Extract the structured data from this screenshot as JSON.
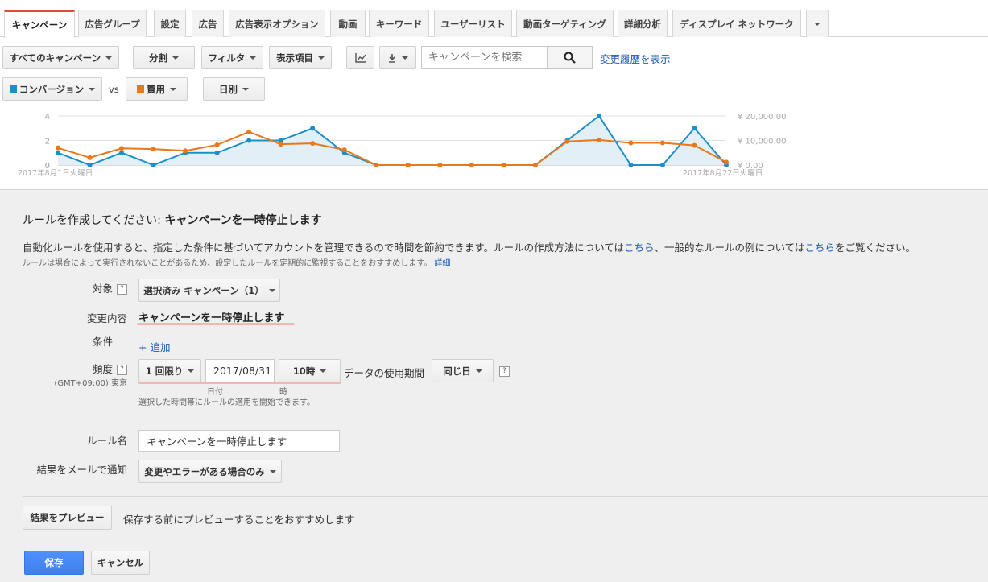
{
  "tabs": [
    "キャンペーン",
    "広告グループ",
    "設定",
    "広告",
    "広告表示オプション",
    "動画",
    "キーワード",
    "ユーザーリスト",
    "動画ターゲティング",
    "詳細分析",
    "ディスプレイ ネットワーク"
  ],
  "toolbar": {
    "all_campaigns": "すべてのキャンペーン",
    "segment": "分割",
    "filter": "フィルタ",
    "columns": "表示項目",
    "search_placeholder": "キャンペーンを検索",
    "change_history": "変更履歴を表示"
  },
  "metrics": {
    "metric1": "コンバージョン",
    "vs": "vs",
    "metric2": "費用",
    "period": "日別",
    "color1": "#1a8fc9",
    "color2": "#e8781c"
  },
  "chart_data": {
    "type": "line",
    "x": [
      "2017年8月1日火曜日",
      "",
      "",
      "",
      "",
      "",
      "",
      "",
      "",
      "",
      "",
      "",
      "",
      "",
      "",
      "",
      "",
      "",
      "",
      "",
      "",
      "2017年8月22日火曜日"
    ],
    "x_labels": [
      "2017年8月1日火曜日",
      "2017年8月22日火曜日"
    ],
    "left_ticks": [
      "4",
      "2",
      "0"
    ],
    "right_ticks": [
      "¥ 20,000.00",
      "¥ 10,000.00",
      "¥ 0.00"
    ],
    "series": [
      {
        "name": "コンバージョン",
        "axis": "left",
        "values": [
          1,
          0,
          1,
          0,
          1,
          1,
          2,
          2,
          3,
          1,
          0,
          0,
          0,
          0,
          0,
          0,
          2,
          4,
          0,
          0,
          3,
          0
        ]
      },
      {
        "name": "費用",
        "axis": "right",
        "values": [
          7000,
          3000,
          6800,
          6500,
          5800,
          8200,
          13500,
          8500,
          8800,
          6200,
          0,
          0,
          0,
          0,
          0,
          0,
          9600,
          10200,
          9000,
          9000,
          8000,
          1200
        ]
      }
    ],
    "ylim_left": [
      0,
      4
    ],
    "ylim_right": [
      0,
      20000
    ]
  },
  "rule": {
    "title_prefix": "ルールを作成してください: ",
    "title_bold": "キャンペーンを一時停止します",
    "desc_a": "自動化ルールを使用すると、指定した条件に基づいてアカウントを管理できるので時間を節約できます。ルールの作成方法については",
    "link1": "こちら",
    "desc_b": "、一般的なルールの例については",
    "link2": "こちら",
    "desc_c": "をご覧ください。",
    "note": "ルールは場合によって実行されないことがあるため、設定したルールを定期的に監視することをおすすめします。",
    "note_link": "詳細",
    "target_label": "対象",
    "target_value": "選択済み キャンペーン（1）",
    "change_label": "変更内容",
    "change_value": "キャンペーンを一時停止します",
    "condition_label": "条件",
    "add_link": "+ 追加",
    "freq_label": "頻度",
    "timezone": "(GMT+09:00) 東京",
    "freq_value": "1 回限り",
    "date_value": "2017/08/31",
    "hour_value": "10時",
    "data_period_label": "データの使用期間",
    "data_period_value": "同じ日",
    "date_sub": "日付",
    "hour_sub": "時",
    "start_note": "選択した時間帯にルールの適用を開始できます。",
    "name_label": "ルール名",
    "name_value": "キャンペーンを一時停止します",
    "email_label": "結果をメールで通知",
    "email_value": "変更やエラーがある場合のみ",
    "preview_button": "結果をプレビュー",
    "preview_note": "保存する前にプレビューすることをおすすめします",
    "save": "保存",
    "cancel": "キャンセル"
  }
}
